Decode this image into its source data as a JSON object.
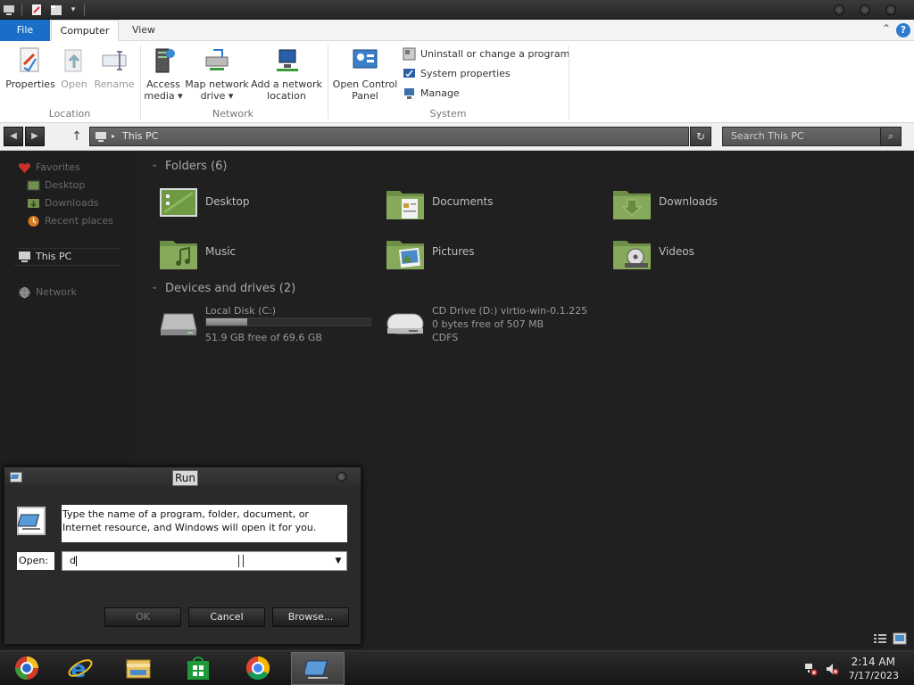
{
  "ribbon": {
    "tabs": {
      "file": "File",
      "computer": "Computer",
      "view": "View"
    },
    "location_group": {
      "label": "Location",
      "properties": "Properties",
      "open": "Open",
      "rename": "Rename"
    },
    "network_group": {
      "label": "Network",
      "access_media_1": "Access",
      "access_media_2": "media ▾",
      "map_drive_1": "Map network",
      "map_drive_2": "drive ▾",
      "add_location_1": "Add a network",
      "add_location_2": "location"
    },
    "system_group": {
      "label": "System",
      "control_panel_1": "Open Control",
      "control_panel_2": "Panel",
      "uninstall": "Uninstall or change a program",
      "system_properties": "System properties",
      "manage": "Manage"
    }
  },
  "address": {
    "path": "This PC",
    "search_placeholder": "Search This PC"
  },
  "navpane": {
    "favorites": "Favorites",
    "desktop": "Desktop",
    "downloads": "Downloads",
    "recent": "Recent places",
    "this_pc": "This PC",
    "network": "Network"
  },
  "content": {
    "folders_header": "Folders (6)",
    "folders": [
      {
        "name": "Desktop"
      },
      {
        "name": "Documents"
      },
      {
        "name": "Downloads"
      },
      {
        "name": "Music"
      },
      {
        "name": "Pictures"
      },
      {
        "name": "Videos"
      }
    ],
    "drives_header": "Devices and drives (2)",
    "drives": [
      {
        "name": "Local Disk (C:)",
        "detail": "51.9 GB free of 69.6 GB",
        "used_fraction": 0.25
      },
      {
        "name": "CD Drive (D:) virtio-win-0.1.225",
        "detail": "0 bytes free of 507 MB",
        "fs": "CDFS"
      }
    ]
  },
  "run_dialog": {
    "title": "Run",
    "description": "Type the name of a program, folder, document, or Internet resource, and Windows will open it for you.",
    "open_label": "Open:",
    "input_value": "d",
    "ok": "OK",
    "cancel": "Cancel",
    "browse": "Browse..."
  },
  "taskbar": {
    "apps": [
      "explorer-color-icon",
      "internet-explorer-icon",
      "file-explorer-icon",
      "store-icon",
      "chrome-icon",
      "run-icon"
    ],
    "time": "2:14 AM",
    "date": "7/17/2023"
  },
  "colors": {
    "accent": "#1a6ec7",
    "folder_green": "#7fa35a",
    "background": "#202020"
  }
}
